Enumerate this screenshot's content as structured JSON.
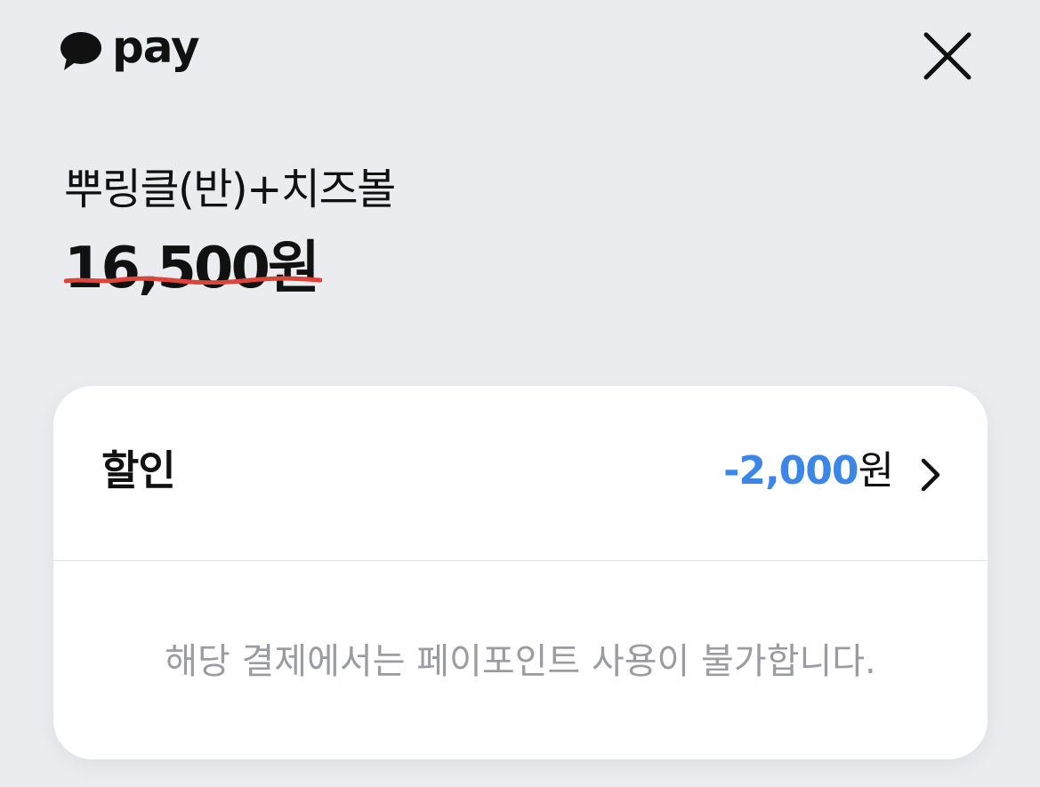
{
  "header": {
    "logo_text": "pay",
    "logo_icon": "speech-bubble-icon",
    "close_icon": "close-icon"
  },
  "product": {
    "name": "뿌링클(반)+치즈볼",
    "original_price": "16,500원"
  },
  "discount": {
    "label": "할인",
    "amount": "-2,000",
    "unit": "원",
    "chevron_icon": "chevron-right-icon"
  },
  "notice": "해당 결제에서는 페이포인트 사용이 불가합니다.",
  "colors": {
    "background": "#ebecef",
    "accent_blue": "#3b86e6",
    "strike_red": "#e0433a",
    "muted_text": "#9a9ca2"
  }
}
